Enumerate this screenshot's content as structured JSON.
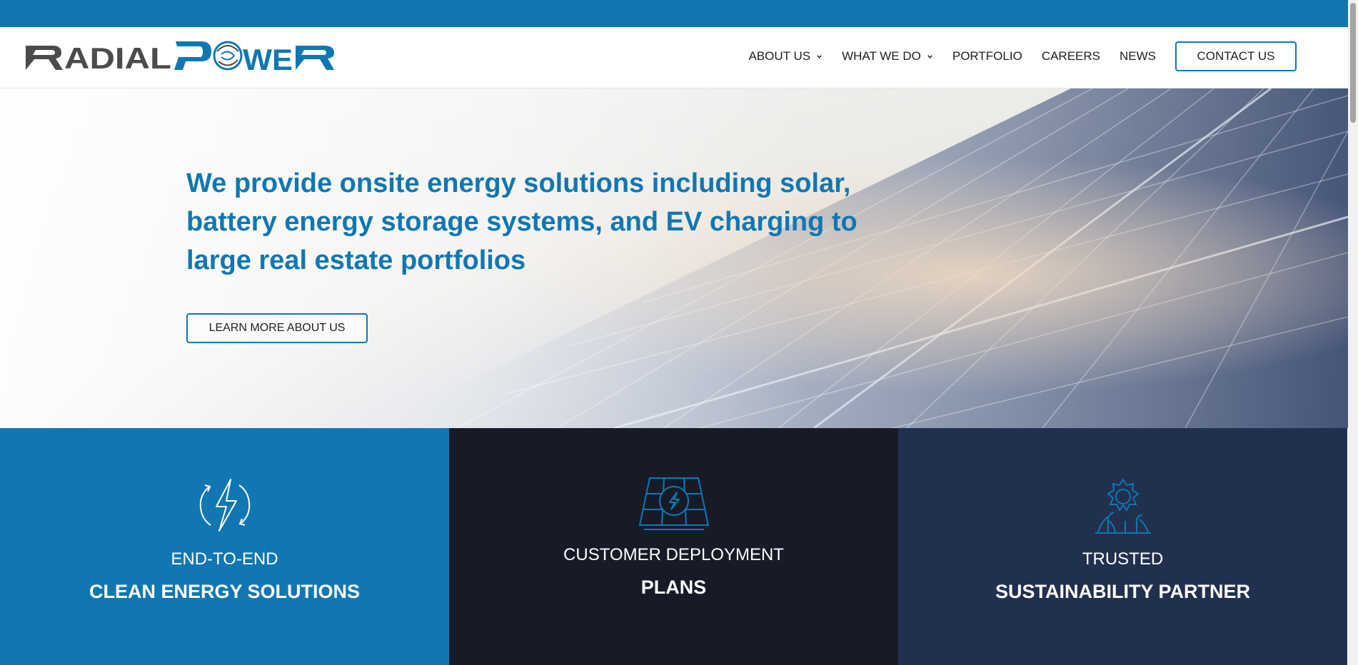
{
  "brand": {
    "logo_text": "RADIALPOWER",
    "colors": {
      "primary_blue": "#1077b2",
      "dark_navy": "#161b27",
      "slate_navy": "#22304f",
      "logo_gray": "#4b4b4b"
    }
  },
  "nav": {
    "items": [
      {
        "label": "ABOUT US",
        "has_dropdown": true
      },
      {
        "label": "WHAT WE DO",
        "has_dropdown": true
      },
      {
        "label": "PORTFOLIO",
        "has_dropdown": false
      },
      {
        "label": "CAREERS",
        "has_dropdown": false
      },
      {
        "label": "NEWS",
        "has_dropdown": false
      }
    ],
    "contact_label": "CONTACT US"
  },
  "hero": {
    "title": "We provide onsite energy solutions including solar, battery energy storage systems, and EV charging to large real estate portfolios",
    "button_label": "LEARN MORE ABOUT US"
  },
  "features": [
    {
      "line1": "END-TO-END",
      "line2": "CLEAN ENERGY SOLUTIONS",
      "icon": "lightning-cycle-icon"
    },
    {
      "line1": "CUSTOMER DEPLOYMENT",
      "line2": "PLANS",
      "icon": "solar-panel-bolt-icon"
    },
    {
      "line1": "TRUSTED",
      "line2": "SUSTAINABILITY PARTNER",
      "icon": "sun-growth-icon"
    }
  ]
}
